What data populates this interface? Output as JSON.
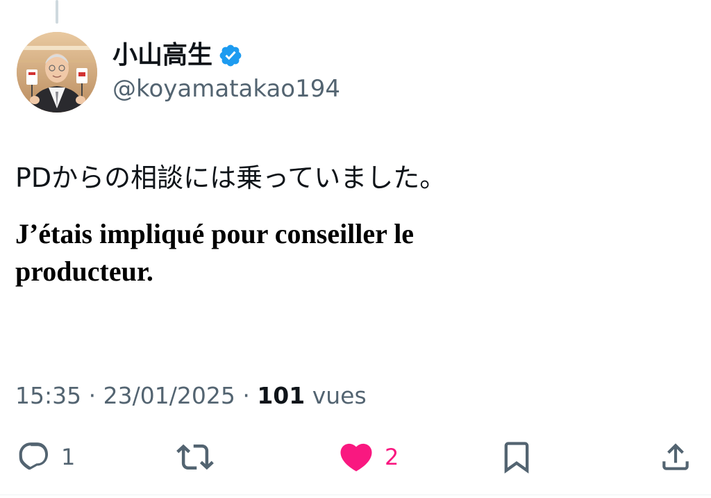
{
  "author": {
    "display_name": "小山高生",
    "handle": "@koyamatakao194",
    "verified": true
  },
  "tweet": {
    "text": "PDからの相談には乗っていました。",
    "translation": "J’étais impliqué pour conseiller le producteur."
  },
  "meta": {
    "time": "15:35",
    "separator": "·",
    "date": "23/01/2025",
    "views_count": "101",
    "views_label": "vues"
  },
  "actions": {
    "reply": {
      "icon": "reply-icon",
      "count": "1"
    },
    "retweet": {
      "icon": "retweet-icon"
    },
    "like": {
      "icon": "heart-icon",
      "count": "2",
      "color": "#f91880"
    },
    "bookmark": {
      "icon": "bookmark-icon"
    },
    "share": {
      "icon": "share-icon"
    }
  },
  "colors": {
    "verified_badge": "#1d9bf0",
    "secondary_text": "#536471",
    "primary_text": "#0f1419",
    "like_active": "#f91880"
  }
}
